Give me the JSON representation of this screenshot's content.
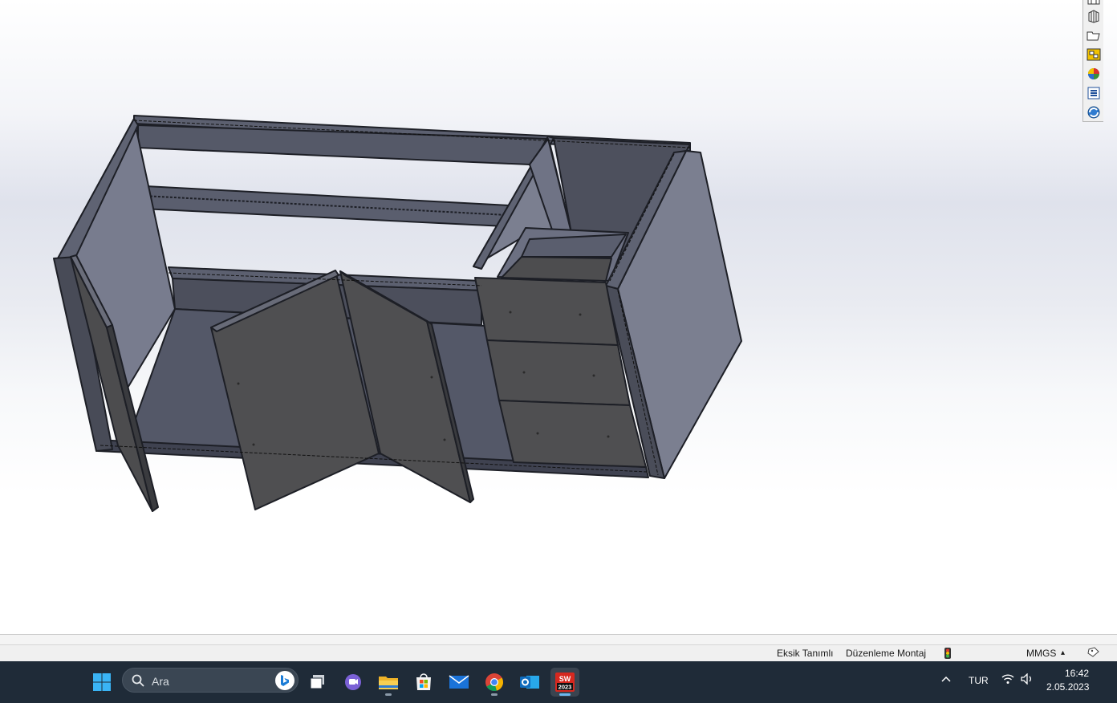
{
  "app": {
    "name": "SolidWorks 2023",
    "document_type": "assembly"
  },
  "task_pane": {
    "buttons": [
      {
        "name": "solidworks-resources-icon"
      },
      {
        "name": "design-library-icon"
      },
      {
        "name": "file-explorer-icon"
      },
      {
        "name": "view-palette-icon"
      },
      {
        "name": "appearances-icon"
      },
      {
        "name": "custom-properties-icon"
      },
      {
        "name": "solidworks-forum-icon"
      }
    ]
  },
  "status_bar": {
    "definition_state": "Eksik Tanımlı",
    "mode": "Düzenleme Montaj",
    "rebuild_icon": "traffic-light-icon",
    "units": "MMGS",
    "units_arrow": "▴"
  },
  "taskbar": {
    "search_placeholder": "Ara",
    "apps": [
      {
        "name": "start-button",
        "icon": "windows-logo-icon"
      },
      {
        "name": "task-view-button",
        "icon": "task-view-icon"
      },
      {
        "name": "teams-chat-button",
        "icon": "teams-icon"
      },
      {
        "name": "file-explorer-button",
        "icon": "folder-icon",
        "running": true
      },
      {
        "name": "microsoft-store-button",
        "icon": "store-icon"
      },
      {
        "name": "mail-button",
        "icon": "mail-icon"
      },
      {
        "name": "chrome-button",
        "icon": "chrome-icon",
        "running": true
      },
      {
        "name": "outlook-button",
        "icon": "outlook-icon"
      },
      {
        "name": "solidworks-button",
        "icon": "solidworks-icon",
        "active": true
      }
    ],
    "solidworks_badge_top": "SW",
    "solidworks_badge_year": "2023",
    "tray": {
      "language": "TUR",
      "time": "16:42",
      "date": "2.05.2023"
    }
  },
  "colors": {
    "panel_light": "#7b7f90",
    "panel_mid": "#5a5e6e",
    "panel_dark": "#4d4f5c",
    "door_face": "#4f4f51",
    "edge": "#1d1f26",
    "taskbar_bg": "#1f2b38"
  }
}
